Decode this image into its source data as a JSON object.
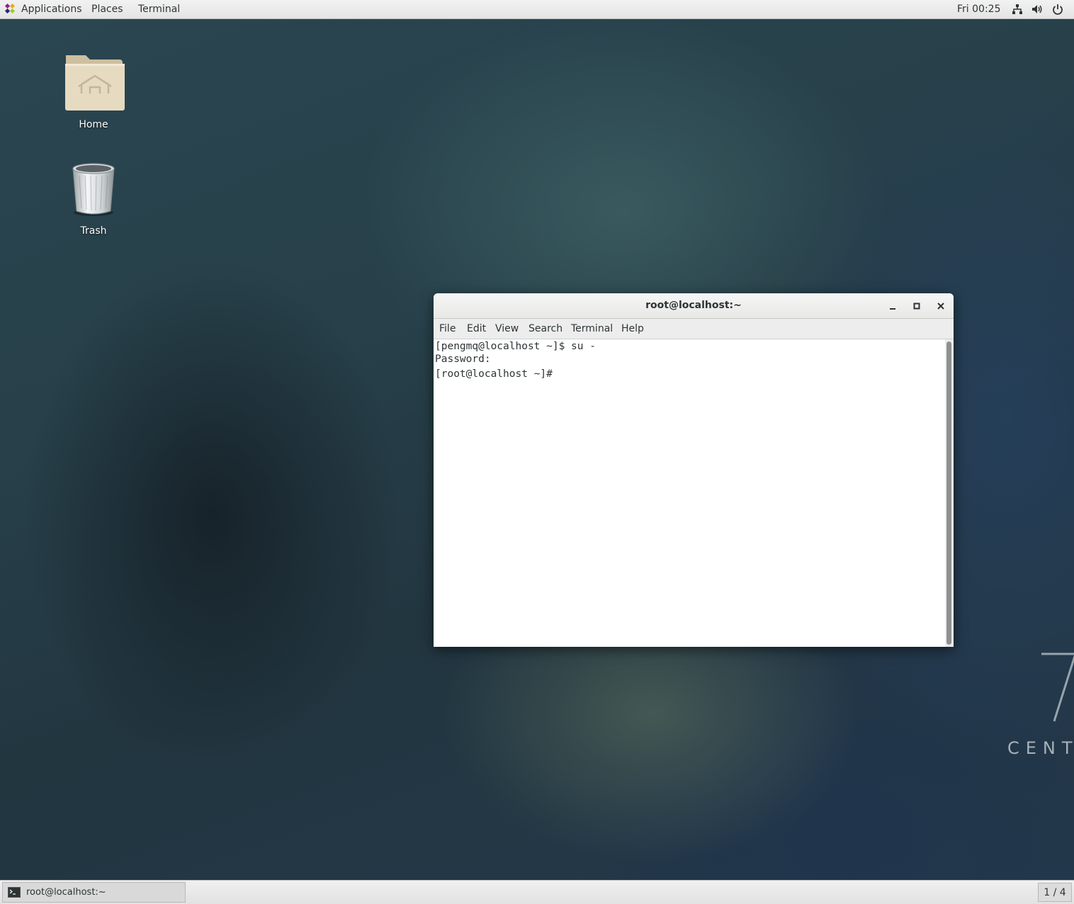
{
  "top_panel": {
    "applications_label": "Applications",
    "places_label": "Places",
    "terminal_label": "Terminal",
    "clock": "Fri 00:25",
    "icons": [
      "app-logo-icon",
      "network-icon",
      "volume-icon",
      "power-icon"
    ]
  },
  "desktop": {
    "icons": [
      {
        "label": "Home",
        "icon": "home-folder-icon"
      },
      {
        "label": "Trash",
        "icon": "trash-icon"
      }
    ],
    "watermark": {
      "text": "CENT",
      "numeral_icon": "centos-seven-logo"
    }
  },
  "terminal_window": {
    "title": "root@localhost:~",
    "menu": [
      "File",
      "Edit",
      "View",
      "Search",
      "Terminal",
      "Help"
    ],
    "lines": [
      "[pengmq@localhost ~]$ su -",
      "Password:",
      "[root@localhost ~]# "
    ],
    "buttons": [
      "minimize-icon",
      "maximize-icon",
      "close-icon"
    ]
  },
  "bottom_panel": {
    "task_label": "root@localhost:~",
    "workspace": "1 / 4"
  },
  "colors": {
    "panel_bg": "#ececec",
    "desktop_bg": "#24384a",
    "terminal_bg": "#ffffff",
    "text": "#2e3436"
  }
}
